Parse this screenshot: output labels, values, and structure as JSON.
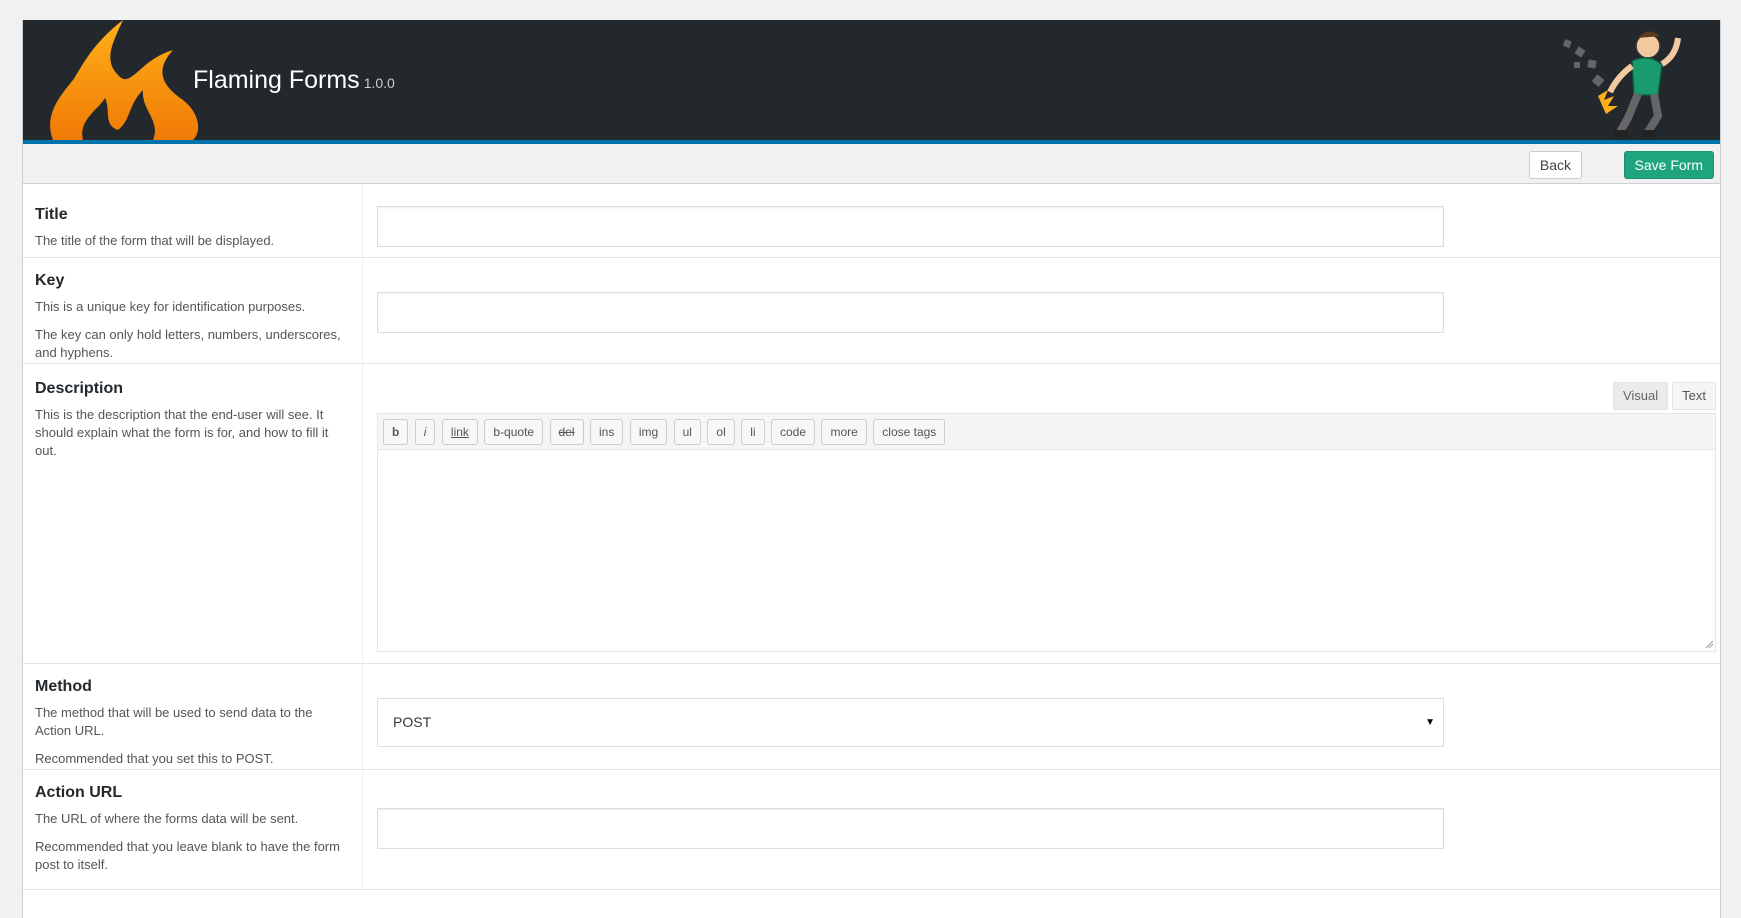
{
  "header": {
    "app_name": "Flaming Forms",
    "version": "1.0.0",
    "brand_flame_color": "#f78c0f",
    "header_bg": "#23282d",
    "accent_bar": "#0073aa"
  },
  "toolbar": {
    "back_label": "Back",
    "save_label": "Save Form",
    "save_color": "#1fa57e"
  },
  "fields": {
    "title": {
      "label": "Title",
      "help": [
        "The title of the form that will be displayed."
      ],
      "value": ""
    },
    "key": {
      "label": "Key",
      "help": [
        "This is a unique key for identification purposes.",
        "The key can only hold letters, numbers, underscores, and hyphens."
      ],
      "value": ""
    },
    "description": {
      "label": "Description",
      "help": [
        "This is the description that the end-user will see. It should explain what the form is for, and how to fill it out."
      ],
      "tabs": [
        "Visual",
        "Text"
      ],
      "quicktags": [
        "b",
        "i",
        "link",
        "b-quote",
        "del",
        "ins",
        "img",
        "ul",
        "ol",
        "li",
        "code",
        "more",
        "close tags"
      ],
      "value": ""
    },
    "method": {
      "label": "Method",
      "help": [
        "The method that will be used to send data to the Action URL.",
        "Recommended that you set this to POST."
      ],
      "selected": "POST"
    },
    "action_url": {
      "label": "Action URL",
      "help": [
        "The URL of where the forms data will be sent.",
        "Recommended that you leave blank to have the form post to itself."
      ],
      "value": ""
    }
  }
}
